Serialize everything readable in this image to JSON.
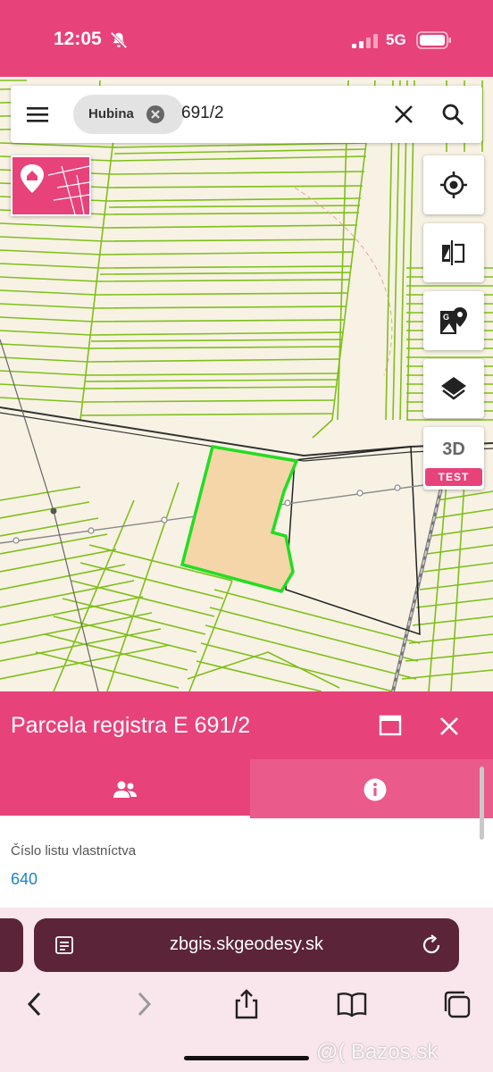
{
  "status_bar": {
    "time": "12:05",
    "network": "5G"
  },
  "search": {
    "filter_chip": "Hubina",
    "query": "691/2"
  },
  "map": {
    "button_3d": "3D",
    "test_badge": "TEST"
  },
  "panel": {
    "title": "Parcela registra E 691/2",
    "field_label": "Číslo listu vlastníctva",
    "field_value": "640"
  },
  "browser": {
    "url": "zbgis.skgeodesy.sk"
  },
  "watermark": "@( Bazos.sk",
  "colors": {
    "brand": "#e8427a",
    "parcel_fill": "#f5d6a8",
    "parcel_outline": "#22dd22",
    "map_lines": "#7fbf1a",
    "browser_bar": "#5c2438",
    "link": "#1b82c9"
  },
  "icons": [
    "menu-icon",
    "close-icon",
    "search-icon",
    "locate-icon",
    "compare-icon",
    "google-maps-icon",
    "layers-icon",
    "people-icon",
    "info-icon",
    "maximize-icon",
    "reader-icon",
    "reload-icon",
    "back-icon",
    "forward-icon",
    "share-icon",
    "bookmarks-icon",
    "tabs-icon"
  ]
}
